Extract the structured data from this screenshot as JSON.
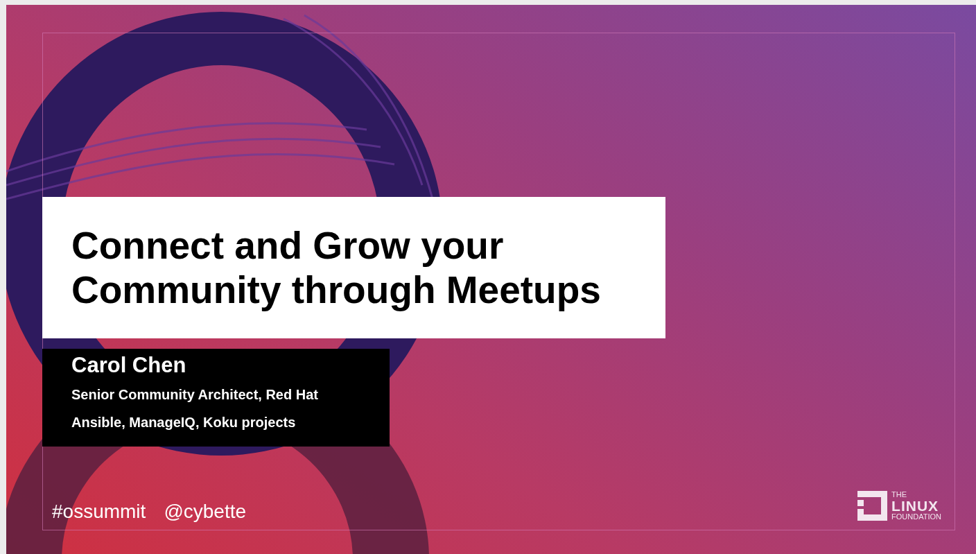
{
  "slide": {
    "title_lines": [
      "Connect and Grow your",
      "Community through Meetups"
    ],
    "speaker": {
      "name": "Carol Chen",
      "role": "Senior Community Architect, Red Hat",
      "projects": "Ansible, ManageIQ, Koku projects"
    },
    "footer": {
      "hashtag": "#ossummit",
      "handle": "@cybette"
    },
    "logo": {
      "line_1": "THE",
      "line_2": "LINUX",
      "line_3": "FOUNDATION"
    }
  }
}
